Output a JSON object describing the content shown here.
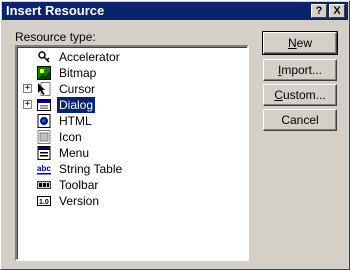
{
  "window": {
    "title": "Insert Resource",
    "help_glyph": "?",
    "close_glyph": "X"
  },
  "tree": {
    "label": "Resource type:",
    "items": [
      {
        "label": "Accelerator",
        "icon": "accelerator-icon",
        "expander": ""
      },
      {
        "label": "Bitmap",
        "icon": "bitmap-icon",
        "expander": ""
      },
      {
        "label": "Cursor",
        "icon": "cursor-icon",
        "expander": "+"
      },
      {
        "label": "Dialog",
        "icon": "dialog-icon",
        "expander": "+",
        "selected": true
      },
      {
        "label": "HTML",
        "icon": "html-icon",
        "expander": ""
      },
      {
        "label": "Icon",
        "icon": "icon-resource-icon",
        "expander": ""
      },
      {
        "label": "Menu",
        "icon": "menu-icon",
        "expander": ""
      },
      {
        "label": "String Table",
        "icon": "string-table-icon",
        "expander": ""
      },
      {
        "label": "Toolbar",
        "icon": "toolbar-icon",
        "expander": ""
      },
      {
        "label": "Version",
        "icon": "version-icon",
        "expander": ""
      }
    ]
  },
  "buttons": {
    "new": {
      "label": "New",
      "mnemonic": "N"
    },
    "import": {
      "label": "Import...",
      "mnemonic": "I"
    },
    "custom": {
      "label": "Custom...",
      "mnemonic": "C"
    },
    "cancel": {
      "label": "Cancel"
    }
  },
  "colors": {
    "titlebar": "#0a246a",
    "face": "#d4d0c8",
    "selection": "#0a246a"
  }
}
